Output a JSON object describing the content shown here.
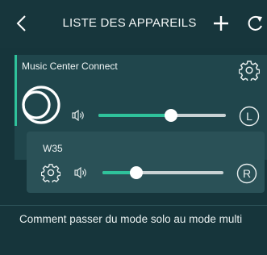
{
  "header": {
    "title": "LISTE DES APPAREILS",
    "back_icon": "chevron-left-icon",
    "add_icon": "plus-icon",
    "refresh_icon": "refresh-icon"
  },
  "devices": [
    {
      "name": "Music Center Connect",
      "volume_fraction": 0.57,
      "channel": "L",
      "icons": [
        "gear-icon",
        "speaker-icon",
        "sony-music-center-logo"
      ]
    },
    {
      "name": "W35",
      "volume_fraction": 0.28,
      "channel": "R",
      "icons": [
        "gear-icon",
        "speaker-icon"
      ]
    }
  ],
  "footer": {
    "help_link": "Comment passer du mode solo au mode multi"
  },
  "colors": {
    "background": "#16353b",
    "card": "#20464c",
    "card_secondary": "#2a5157",
    "accent": "#2fc29b",
    "slider_track": "#c9d2d4"
  }
}
